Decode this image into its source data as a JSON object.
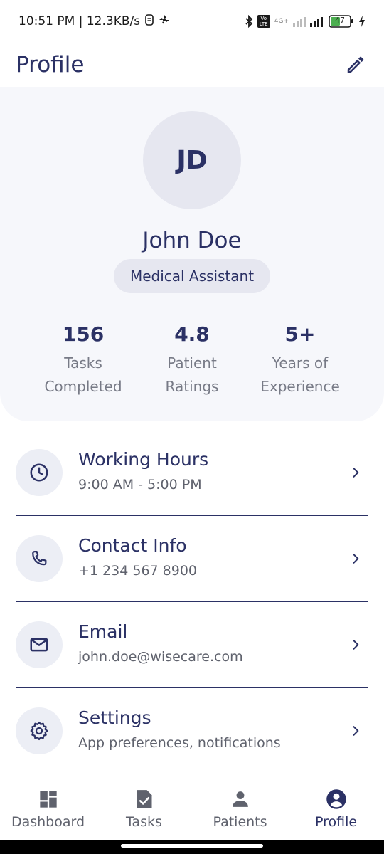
{
  "status_bar": {
    "time_speed": "10:51 PM | 12.3KB/s",
    "network_type": "4G+",
    "volte": "Vo LTE",
    "battery_level": "47",
    "icons": [
      "sim-icon",
      "fan-icon",
      "bluetooth-icon",
      "signal-icon",
      "battery-icon",
      "charging-icon"
    ]
  },
  "header": {
    "title": "Profile",
    "edit_icon": "pencil-icon"
  },
  "profile": {
    "initials": "JD",
    "name": "John Doe",
    "role": "Medical Assistant"
  },
  "stats": [
    {
      "value": "156",
      "label_line1": "Tasks",
      "label_line2": "Completed"
    },
    {
      "value": "4.8",
      "label_line1": "Patient",
      "label_line2": "Ratings"
    },
    {
      "value": "5+",
      "label_line1": "Years of",
      "label_line2": "Experience"
    }
  ],
  "info_items": [
    {
      "title": "Working Hours",
      "subtitle": "9:00 AM - 5:00 PM",
      "icon": "clock-icon"
    },
    {
      "title": "Contact Info",
      "subtitle": "+1 234 567 8900",
      "icon": "phone-icon"
    },
    {
      "title": "Email",
      "subtitle": "john.doe@wisecare.com",
      "icon": "mail-icon"
    },
    {
      "title": "Settings",
      "subtitle": "App preferences, notifications",
      "icon": "gear-icon"
    }
  ],
  "bottom_nav": [
    {
      "label": "Dashboard",
      "icon": "dashboard-icon",
      "active": false
    },
    {
      "label": "Tasks",
      "icon": "task-check-icon",
      "active": false
    },
    {
      "label": "Patients",
      "icon": "person-icon",
      "active": false
    },
    {
      "label": "Profile",
      "icon": "account-circle-icon",
      "active": true
    }
  ],
  "colors": {
    "primary": "#2b3165",
    "card_background": "#f6f7fb",
    "chip_background": "#e6e7f0",
    "secondary_text": "#5f626d"
  }
}
